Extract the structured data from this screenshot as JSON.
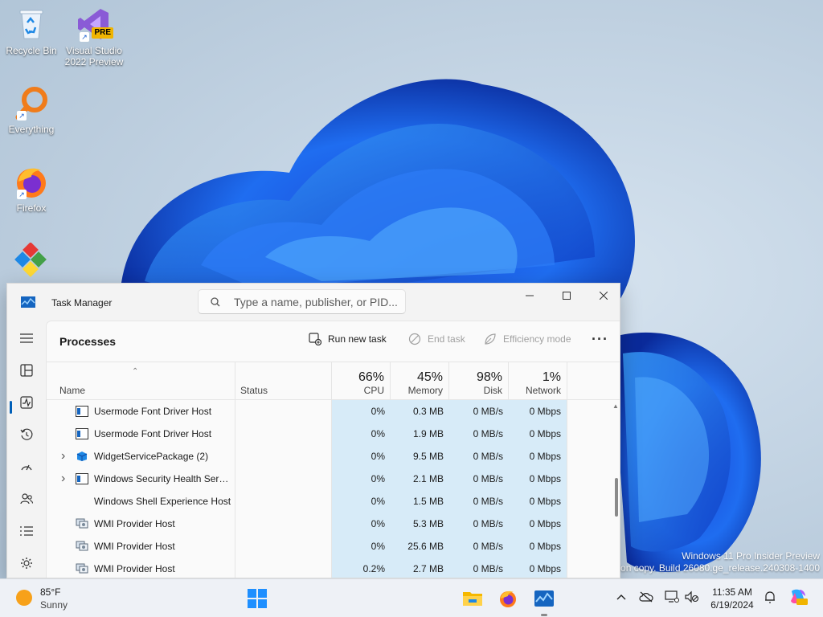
{
  "desktop": {
    "icons": [
      {
        "label": "Recycle Bin",
        "icon": "recycle-bin-icon"
      },
      {
        "label": "Visual Studio 2022 Preview",
        "icon": "visual-studio-icon",
        "badge": "PRE"
      },
      {
        "label": "Everything",
        "icon": "everything-search-icon"
      },
      {
        "label": "Firefox",
        "icon": "firefox-icon"
      },
      {
        "label": "",
        "icon": "app-shortcut-icon"
      }
    ],
    "watermark_line1": "Windows 11 Pro Insider Preview",
    "watermark_line2": "ation copy. Build 26080.ge_release.240308-1400"
  },
  "task_manager": {
    "title": "Task Manager",
    "search_placeholder": "Type a name, publisher, or PID...",
    "page_title": "Processes",
    "commands": {
      "run_new_task": "Run new task",
      "end_task": "End task",
      "efficiency_mode": "Efficiency mode",
      "more": "···"
    },
    "nav": [
      {
        "name": "nav-menu",
        "icon": "hamburger-icon"
      },
      {
        "name": "nav-processes",
        "icon": "processes-icon",
        "active": true
      },
      {
        "name": "nav-performance",
        "icon": "performance-icon"
      },
      {
        "name": "nav-app-history",
        "icon": "history-icon"
      },
      {
        "name": "nav-startup-apps",
        "icon": "startup-icon"
      },
      {
        "name": "nav-users",
        "icon": "users-icon"
      },
      {
        "name": "nav-details",
        "icon": "details-icon"
      },
      {
        "name": "nav-services",
        "icon": "services-icon"
      }
    ],
    "columns": {
      "name": "Name",
      "status": "Status",
      "cpu_pct": "66%",
      "cpu": "CPU",
      "memory_pct": "45%",
      "memory": "Memory",
      "disk_pct": "98%",
      "disk": "Disk",
      "network_pct": "1%",
      "network": "Network"
    },
    "processes": [
      {
        "name": "Usermode Font Driver Host",
        "expandable": false,
        "icon": "window-process-icon",
        "status": "",
        "cpu": "0%",
        "memory": "0.3 MB",
        "disk": "0 MB/s",
        "network": "0 Mbps"
      },
      {
        "name": "Usermode Font Driver Host",
        "expandable": false,
        "icon": "window-process-icon",
        "status": "",
        "cpu": "0%",
        "memory": "1.9 MB",
        "disk": "0 MB/s",
        "network": "0 Mbps"
      },
      {
        "name": "WidgetServicePackage (2)",
        "expandable": true,
        "icon": "widget-package-icon",
        "status": "",
        "cpu": "0%",
        "memory": "9.5 MB",
        "disk": "0 MB/s",
        "network": "0 Mbps"
      },
      {
        "name": "Windows Security Health Servi...",
        "expandable": true,
        "icon": "window-process-icon",
        "status": "",
        "cpu": "0%",
        "memory": "2.1 MB",
        "disk": "0 MB/s",
        "network": "0 Mbps"
      },
      {
        "name": "Windows Shell Experience Host",
        "expandable": false,
        "icon": "",
        "status": "",
        "cpu": "0%",
        "memory": "1.5 MB",
        "disk": "0 MB/s",
        "network": "0 Mbps"
      },
      {
        "name": "WMI Provider Host",
        "expandable": false,
        "icon": "wmi-icon",
        "status": "",
        "cpu": "0%",
        "memory": "5.3 MB",
        "disk": "0 MB/s",
        "network": "0 Mbps"
      },
      {
        "name": "WMI Provider Host",
        "expandable": false,
        "icon": "wmi-icon",
        "status": "",
        "cpu": "0%",
        "memory": "25.6 MB",
        "disk": "0 MB/s",
        "network": "0 Mbps"
      },
      {
        "name": "WMI Provider Host",
        "expandable": false,
        "icon": "wmi-icon",
        "status": "",
        "cpu": "0.2%",
        "memory": "2.7 MB",
        "disk": "0 MB/s",
        "network": "0 Mbps"
      }
    ],
    "colors": {
      "accent": "#005fb8",
      "heat_tint": "#d7ebf8"
    }
  },
  "taskbar": {
    "weather_temp": "85°F",
    "weather_condition": "Sunny",
    "apps": [
      {
        "name": "start-button",
        "icon": "windows-logo-icon"
      },
      {
        "name": "file-explorer",
        "icon": "folder-icon"
      },
      {
        "name": "firefox",
        "icon": "firefox-icon"
      },
      {
        "name": "task-manager",
        "icon": "task-manager-icon",
        "running": true
      }
    ],
    "time": "11:35 AM",
    "date": "6/19/2024"
  }
}
